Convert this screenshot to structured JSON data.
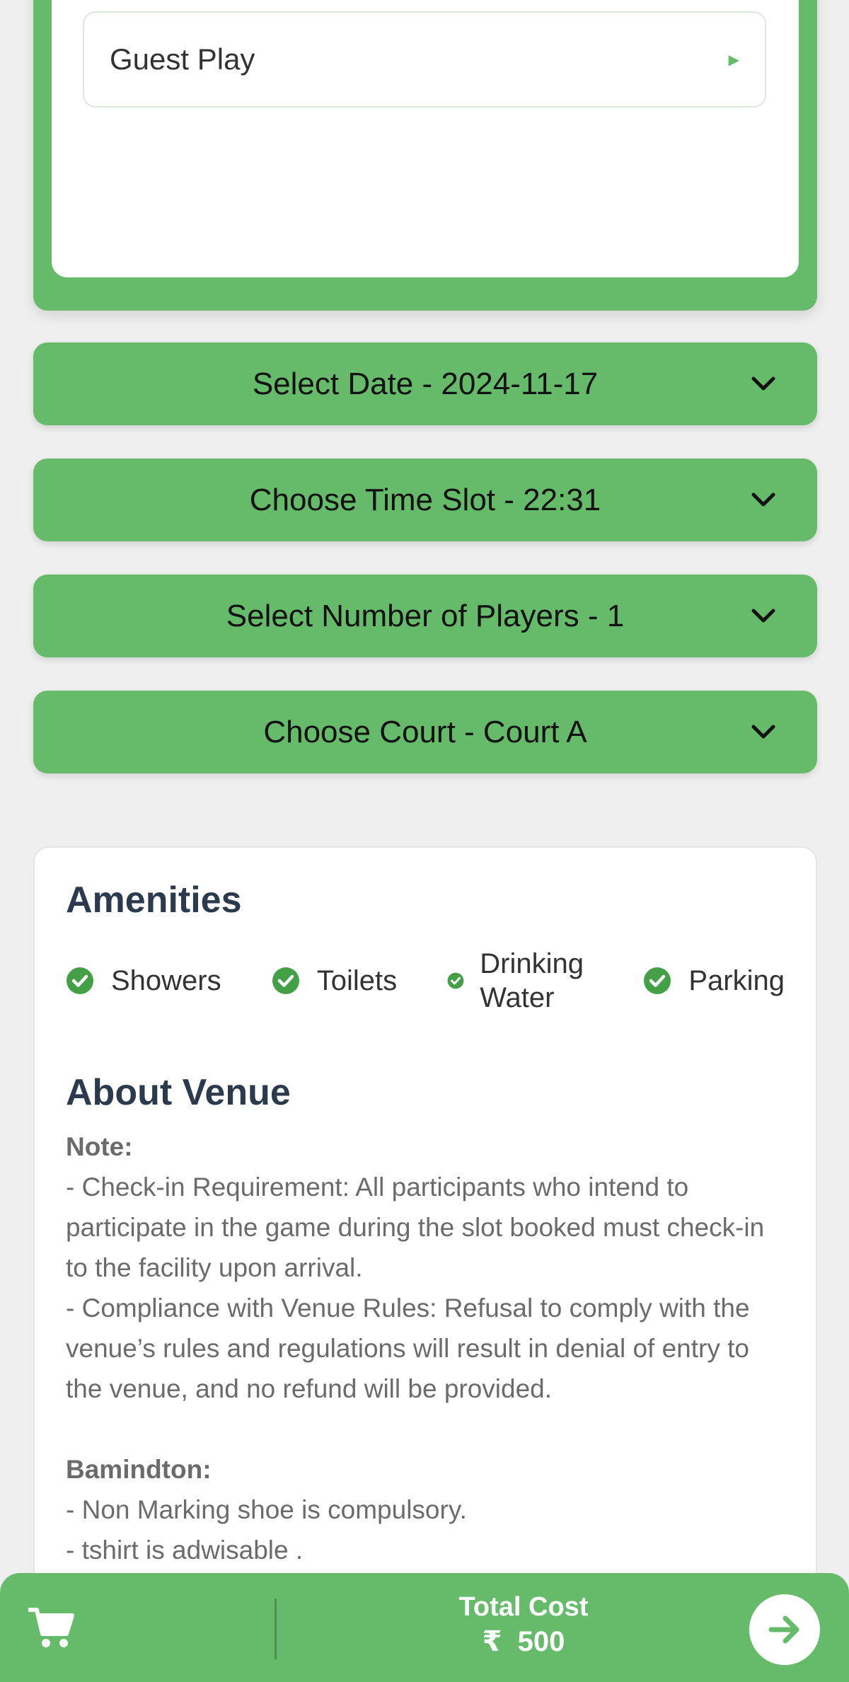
{
  "play_type": {
    "selected": "Guest Play",
    "arrow_icon": "triangle-right-icon"
  },
  "selectors": {
    "date": "Select Date - 2024-11-17",
    "time": "Choose Time Slot - 22:31",
    "players": "Select Number of Players - 1",
    "court": "Choose Court - Court A"
  },
  "amenities": {
    "title": "Amenities",
    "items": [
      {
        "label": "Showers",
        "icon": "check-circle-icon"
      },
      {
        "label": "Toilets",
        "icon": "check-circle-icon"
      },
      {
        "label": "Drinking Water",
        "icon": "check-circle-icon"
      },
      {
        "label": "Parking",
        "icon": "check-circle-icon"
      }
    ]
  },
  "about": {
    "title": "About Venue",
    "note_heading": "Note:",
    "note_lines": [
      "- Check-in Requirement: All participants who intend to participate in the game during the slot booked must check-in to the facility upon arrival.",
      "- Compliance with Venue Rules: Refusal to comply with the venue’s rules and regulations will result in denial of entry to the venue, and no refund will be provided."
    ],
    "sport_heading": "Bamindton:",
    "sport_lines": [
      "- Non Marking shoe is compulsory.",
      "- tshirt is adwisable ."
    ]
  },
  "footer": {
    "total_label": "Total Cost",
    "currency": "₹",
    "amount": "500"
  },
  "colors": {
    "accent": "#66bb6a",
    "check": "#43a047",
    "heading": "#2b3a4d"
  }
}
